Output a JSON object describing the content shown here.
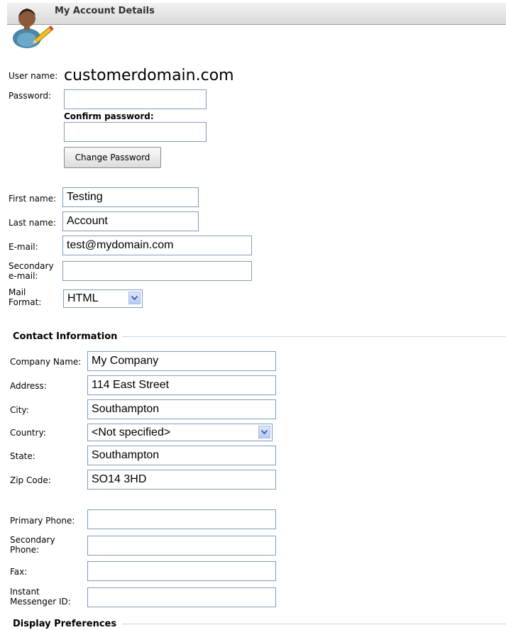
{
  "header": {
    "title": "My Account Details"
  },
  "account": {
    "username_label": "User name:",
    "username_value": "customerdomain.com",
    "password_label": "Password:",
    "password_value": "",
    "confirm_label": "Confirm password:",
    "confirm_value": "",
    "change_password_button": "Change Password"
  },
  "personal": {
    "first_name_label": "First name:",
    "first_name_value": "Testing",
    "last_name_label": "Last name:",
    "last_name_value": "Account",
    "email_label": "E-mail:",
    "email_value": "test@mydomain.com",
    "secondary_email_label_1": "Secondary",
    "secondary_email_label_2": "e-mail:",
    "secondary_email_value": "",
    "mail_format_label_1": "Mail",
    "mail_format_label_2": "Format:",
    "mail_format_value": "HTML"
  },
  "contact": {
    "section_title": "Contact Information",
    "company_label": "Company Name:",
    "company_value": "My Company",
    "address_label": "Address:",
    "address_value": "114 East Street",
    "city_label": "City:",
    "city_value": "Southampton",
    "country_label": "Country:",
    "country_value": "<Not specified>",
    "state_label": "State:",
    "state_value": "Southampton",
    "zip_label": "Zip Code:",
    "zip_value": "SO14 3HD",
    "primary_phone_label": "Primary Phone:",
    "primary_phone_value": "",
    "secondary_phone_label_1": "Secondary",
    "secondary_phone_label_2": "Phone:",
    "secondary_phone_value": "",
    "fax_label": "Fax:",
    "fax_value": "",
    "im_label_1": "Instant",
    "im_label_2": "Messenger ID:",
    "im_value": ""
  },
  "display": {
    "section_title": "Display Preferences"
  },
  "icons": {
    "avatar": "user-edit-icon",
    "dropdown": "chevron-down-icon"
  },
  "colors": {
    "input_border": "#7f9db9",
    "section_line": "#c7d3e0",
    "dropdown_button": "#b6c9f0"
  }
}
